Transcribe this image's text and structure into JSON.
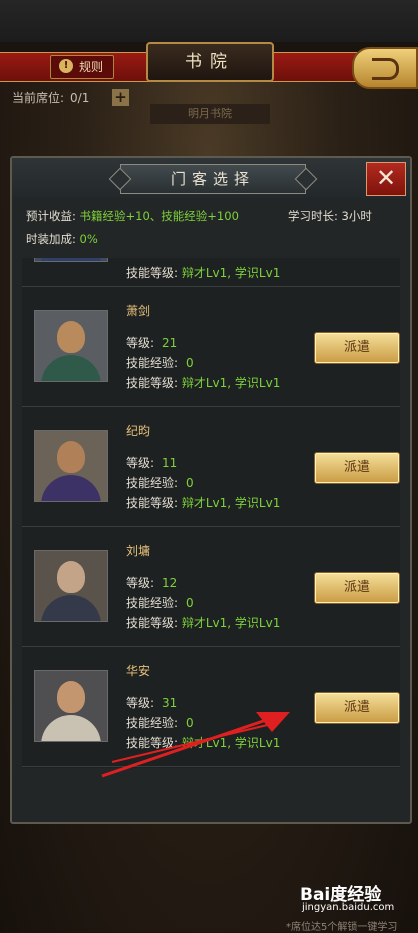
{
  "screen": {
    "title": "书院",
    "rules_label": "规则",
    "seat_label": "当前席位:",
    "seat_value": "0/1",
    "plus_label": "+",
    "plaque_text": "明月书院"
  },
  "modal": {
    "title": "门客选择",
    "close_label": "✕",
    "expected_gain_label": "预计收益:",
    "expected_gain_value": "书籍经验+10、技能经验+100",
    "study_time_label": "学习时长:",
    "study_time_value": "3小时",
    "costume_bonus_label": "时装加成:",
    "costume_bonus_value": "0%"
  },
  "partial_row": {
    "label": "技能等级:",
    "skills": "辩才Lv1, 学识Lv1"
  },
  "field_labels": {
    "level": "等级:",
    "skill_exp": "技能经验:",
    "skill_level": "技能等级:",
    "dispatch": "派遣"
  },
  "retainers": [
    {
      "name": "萧剑",
      "level": "21",
      "skill_exp": "0",
      "skills": "辩才Lv1, 学识Lv1"
    },
    {
      "name": "纪昀",
      "level": "11",
      "skill_exp": "0",
      "skills": "辩才Lv1, 学识Lv1"
    },
    {
      "name": "刘墉",
      "level": "12",
      "skill_exp": "0",
      "skills": "辩才Lv1, 学识Lv1"
    },
    {
      "name": "华安",
      "level": "31",
      "skill_exp": "0",
      "skills": "辩才Lv1, 学识Lv1"
    }
  ],
  "watermark": {
    "logo": "Bai度经验",
    "url": "jingyan.baidu.com"
  },
  "bottom_text": "*席位达5个解锁一键学习",
  "colors": {
    "accent_green": "#7ed23a",
    "name_gold": "#e8c17a",
    "button_gold": "#e0bd6e",
    "arrow_red": "#e02020"
  }
}
